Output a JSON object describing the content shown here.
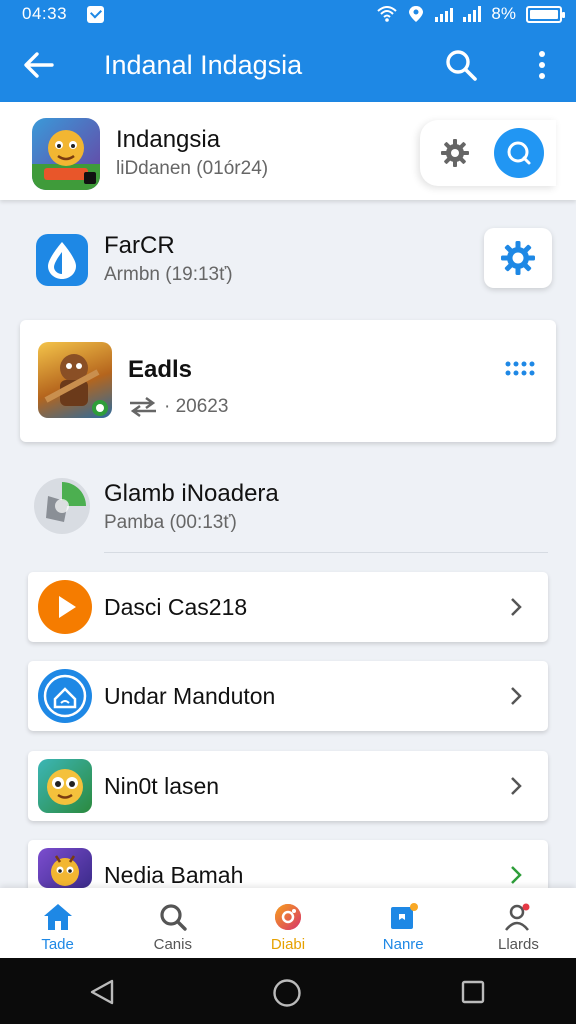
{
  "status_bar": {
    "time": "04:33",
    "battery": "8%"
  },
  "app_bar": {
    "title": "Indanal Indagsia"
  },
  "top_item": {
    "name": "Indangsia",
    "subtitle": "liDdanen (01ór24)"
  },
  "second_item": {
    "name": "FarCR",
    "subtitle": "Armbn (19:13ť)"
  },
  "featured": {
    "name": "Eadls",
    "subtitle": "20623"
  },
  "fourth_item": {
    "name": "Glamb iNoadera",
    "subtitle": "Pamba (00:13ť)"
  },
  "list": [
    {
      "label": "Dasci Cas218"
    },
    {
      "label": "Undar Manduton"
    },
    {
      "label": "Nin0t lasen"
    },
    {
      "label": "Nedia Bamah"
    }
  ],
  "bottom_nav": [
    {
      "label": "Tade",
      "icon": "home-icon"
    },
    {
      "label": "Canis",
      "icon": "search-icon"
    },
    {
      "label": "Diabi",
      "icon": "media-icon"
    },
    {
      "label": "Nanre",
      "icon": "badge-icon"
    },
    {
      "label": "Llards",
      "icon": "profile-icon"
    }
  ],
  "colors": {
    "primary": "#1e88e5",
    "accent_green": "#2e9d3a",
    "accent_orange": "#f57c00"
  }
}
